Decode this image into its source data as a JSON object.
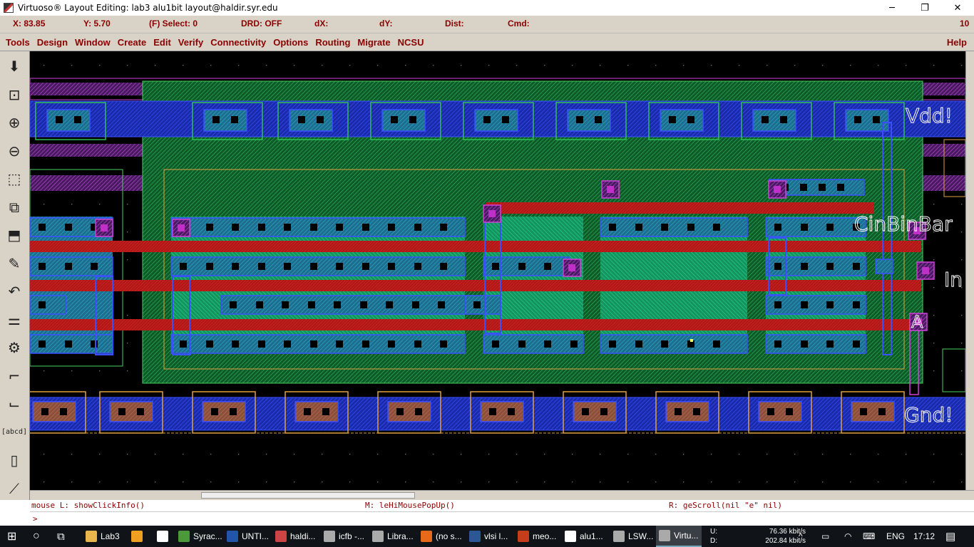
{
  "window": {
    "title": "Virtuoso® Layout Editing: lab3 alu1bit layout@haldir.syr.edu",
    "minimize": "─",
    "maximize": "❐",
    "close": "✕"
  },
  "status": {
    "x": "X:  83.85",
    "y": "Y:  5.70",
    "select": "(F) Select: 0",
    "drd": "DRD: OFF",
    "dx": "dX:",
    "dy": "dY:",
    "dist": "Dist:",
    "cmd": "Cmd:",
    "num": "10"
  },
  "menu": {
    "items": [
      "Tools",
      "Design",
      "Window",
      "Create",
      "Edit",
      "Verify",
      "Connectivity",
      "Options",
      "Routing",
      "Migrate",
      "NCSU"
    ],
    "help": "Help"
  },
  "toolbar": {
    "tools": [
      {
        "name": "save-tool-icon",
        "glyph": "⬇"
      },
      {
        "name": "zoom-fit-tool-icon",
        "glyph": "⊡"
      },
      {
        "name": "zoom-in-tool-icon",
        "glyph": "⊕"
      },
      {
        "name": "zoom-out-tool-icon",
        "glyph": "⊖"
      },
      {
        "name": "stretch-tool-icon",
        "glyph": "⬚"
      },
      {
        "name": "copy-tool-icon",
        "glyph": "⧉"
      },
      {
        "name": "move-tool-icon",
        "glyph": "⬒"
      },
      {
        "name": "delete-tool-icon",
        "glyph": "✎"
      },
      {
        "name": "undo-tool-icon",
        "glyph": "↶"
      },
      {
        "name": "property-tool-icon",
        "glyph": "⚌"
      },
      {
        "name": "instance-tool-icon",
        "glyph": "⚙"
      },
      {
        "name": "path-tool-icon",
        "glyph": "⌐"
      },
      {
        "name": "polygon-tool-icon",
        "glyph": "⌙"
      },
      {
        "name": "label-tool-icon",
        "glyph": "[abcd]"
      },
      {
        "name": "rectangle-tool-icon",
        "glyph": "▯"
      },
      {
        "name": "ruler-tool-icon",
        "glyph": "⟋"
      }
    ]
  },
  "canvas": {
    "labels": {
      "vdd": "Vdd!",
      "gnd": "Gnd!",
      "cinbinbar": "CinBinBar",
      "in": "In",
      "a": "A"
    },
    "colors": {
      "background": "#000000",
      "metal1": "#2a3bd6",
      "poly": "#d21e1e",
      "active": "#1aa870",
      "nwell": "#3ac04a",
      "contact": "#000000",
      "via": "#d21ed2",
      "metal2": "#b84ad8"
    }
  },
  "mouse": {
    "left": "mouse L: showClickInfo()",
    "middle": "M: leHiMousePopUp()",
    "right": "R: geScroll(nil \"e\"     nil)"
  },
  "cmdline": {
    "prompt": ">"
  },
  "taskbar": {
    "apps": [
      {
        "label": "Lab3",
        "color": "#e8b64a"
      },
      {
        "label": "",
        "color": "#f0a020"
      },
      {
        "label": "",
        "color": "#ffffff"
      },
      {
        "label": "Syrac...",
        "color": "#4a9a3a"
      },
      {
        "label": "UNTI...",
        "color": "#2255aa"
      },
      {
        "label": "haldi...",
        "color": "#cc4444"
      },
      {
        "label": "icfb -...",
        "color": "#aaaaaa"
      },
      {
        "label": "Libra...",
        "color": "#aaaaaa"
      },
      {
        "label": "(no s...",
        "color": "#e66a1a"
      },
      {
        "label": "vlsi l...",
        "color": "#2b5797"
      },
      {
        "label": "meo...",
        "color": "#c43e1c"
      },
      {
        "label": "alu1...",
        "color": "#ffffff"
      },
      {
        "label": "LSW...",
        "color": "#aaaaaa"
      },
      {
        "label": "Virtu...",
        "color": "#aaaaaa"
      }
    ],
    "net_u_label": "U:",
    "net_u": "76.36 kbit/s",
    "net_d_label": "D:",
    "net_d": "202.84 kbit/s",
    "lang": "ENG",
    "time": "17:12"
  }
}
